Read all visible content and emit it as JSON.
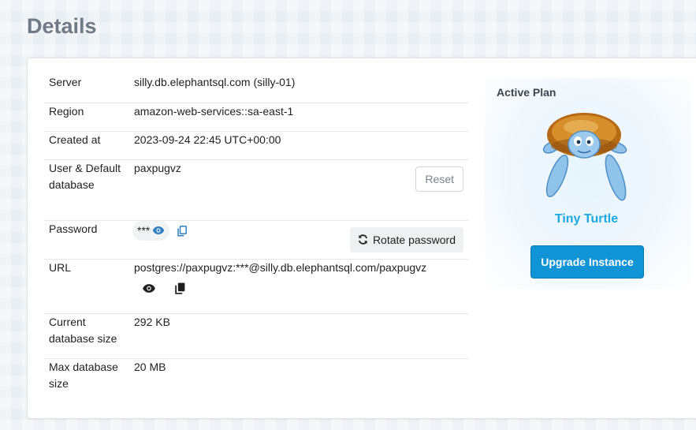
{
  "page": {
    "title": "Details"
  },
  "details": {
    "rows": [
      {
        "label": "Server",
        "value": "silly.db.elephantsql.com (silly-01)"
      },
      {
        "label": "Region",
        "value": "amazon-web-services::sa-east-1"
      },
      {
        "label": "Created at",
        "value": "2023-09-24 22:45 UTC+00:00"
      },
      {
        "label": "User & Default database",
        "value": "paxpugvz"
      },
      {
        "label": "Password",
        "value": "***"
      },
      {
        "label": "URL",
        "value": "postgres://paxpugvz:***@silly.db.elephantsql.com/paxpugvz"
      },
      {
        "label": "Current database size",
        "value": "292 KB"
      },
      {
        "label": "Max database size",
        "value": "20 MB"
      }
    ],
    "reset_label": "Reset",
    "rotate_label": "Rotate password"
  },
  "plan": {
    "label": "Active Plan",
    "name": "Tiny Turtle",
    "upgrade_label": "Upgrade Instance",
    "accent": "#1ca9e0",
    "button_color": "#1194d6"
  },
  "icons": {
    "show_password": "eye-icon",
    "copy_password": "copy-icon",
    "rotate": "refresh-icon",
    "show_url": "eye-icon",
    "copy_url": "copy-icon",
    "mascot": "turtle-icon"
  }
}
